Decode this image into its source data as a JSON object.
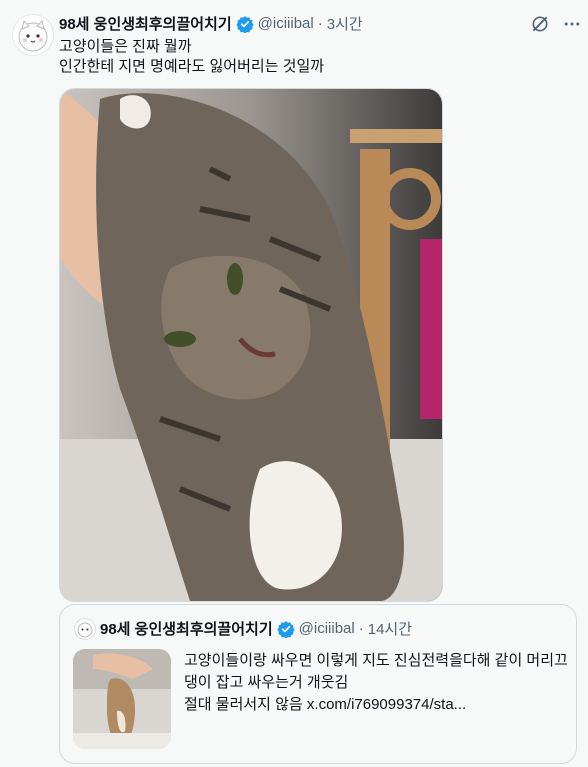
{
  "tweet": {
    "display_name": "98세 웅인생최후의끌어치기",
    "handle": "@iciiibal",
    "separator": "·",
    "time": "3시간",
    "text_lines": [
      "고양이들은 진짜 뭘까",
      "인간한테 지면 명예라도 잃어버리는 것일까"
    ],
    "photo": {
      "icon": "cat-photo"
    }
  },
  "quoted": {
    "display_name": "98세 웅인생최후의끌어치기",
    "handle": "@iciiibal",
    "separator": "·",
    "time": "14시간",
    "text_lines": [
      "고양이들이랑 싸우면 이렇게 지도 진심전력을다해 같이 머리끄",
      "댕이 잡고 싸우는거 개웃김",
      "절대 물러서지 않음  x.com/i769099374/sta..."
    ]
  },
  "colors": {
    "accent": "#1d9bf0",
    "secondary_text": "#536471",
    "border": "#cfd9de"
  },
  "icons": [
    "avatar",
    "verified-badge-icon",
    "grok-icon",
    "more-icon"
  ]
}
